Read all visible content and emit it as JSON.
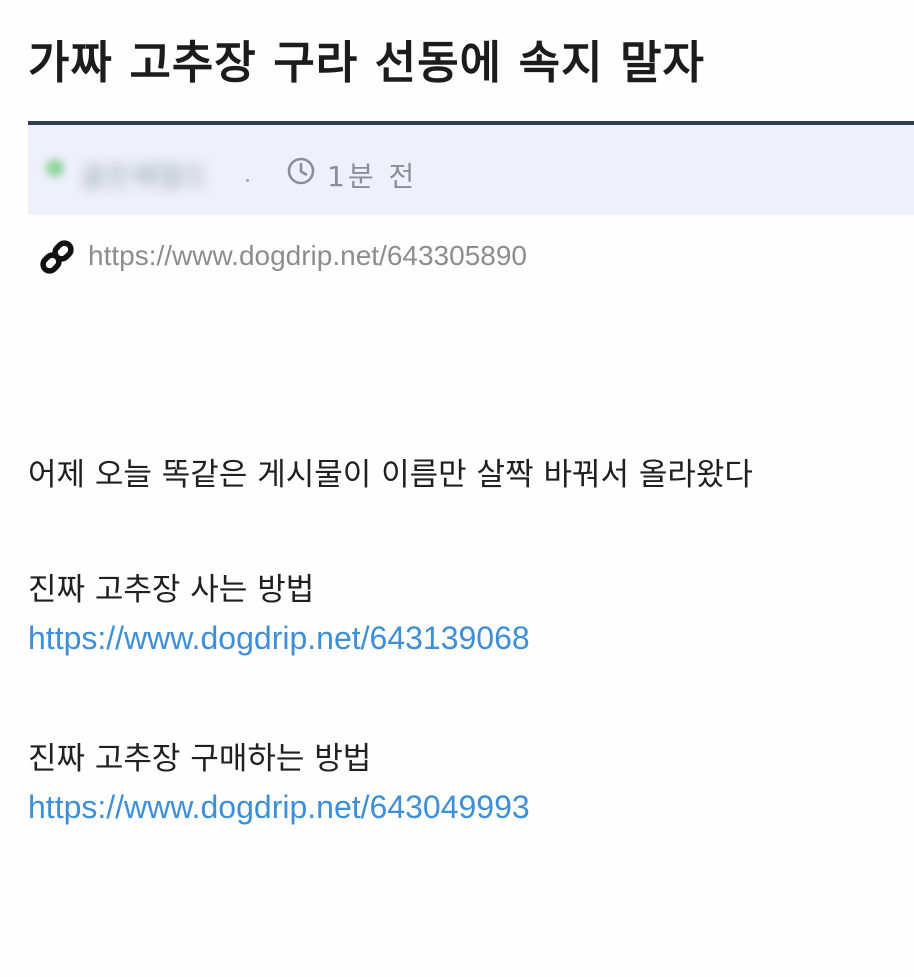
{
  "post": {
    "title": "가짜 고추장 구라 선동에 속지 말자",
    "author": "골든헤럴드",
    "time": "1분 전",
    "url": "https://www.dogdrip.net/643305890"
  },
  "content": {
    "line1": "어제 오늘 똑같은 게시물이 이름만 살짝 바꿔서 올라왔다",
    "section1": {
      "text": "진짜 고추장 사는 방법",
      "link": "https://www.dogdrip.net/643139068"
    },
    "section2": {
      "text": "진짜 고추장 구매하는 방법",
      "link": "https://www.dogdrip.net/643049993"
    }
  },
  "colors": {
    "title_rule": "#2f3d52",
    "meta_bg": "#eef1fb",
    "link": "#3d8fd8"
  },
  "icons": {
    "clock": "clock-icon",
    "link": "link-icon"
  }
}
